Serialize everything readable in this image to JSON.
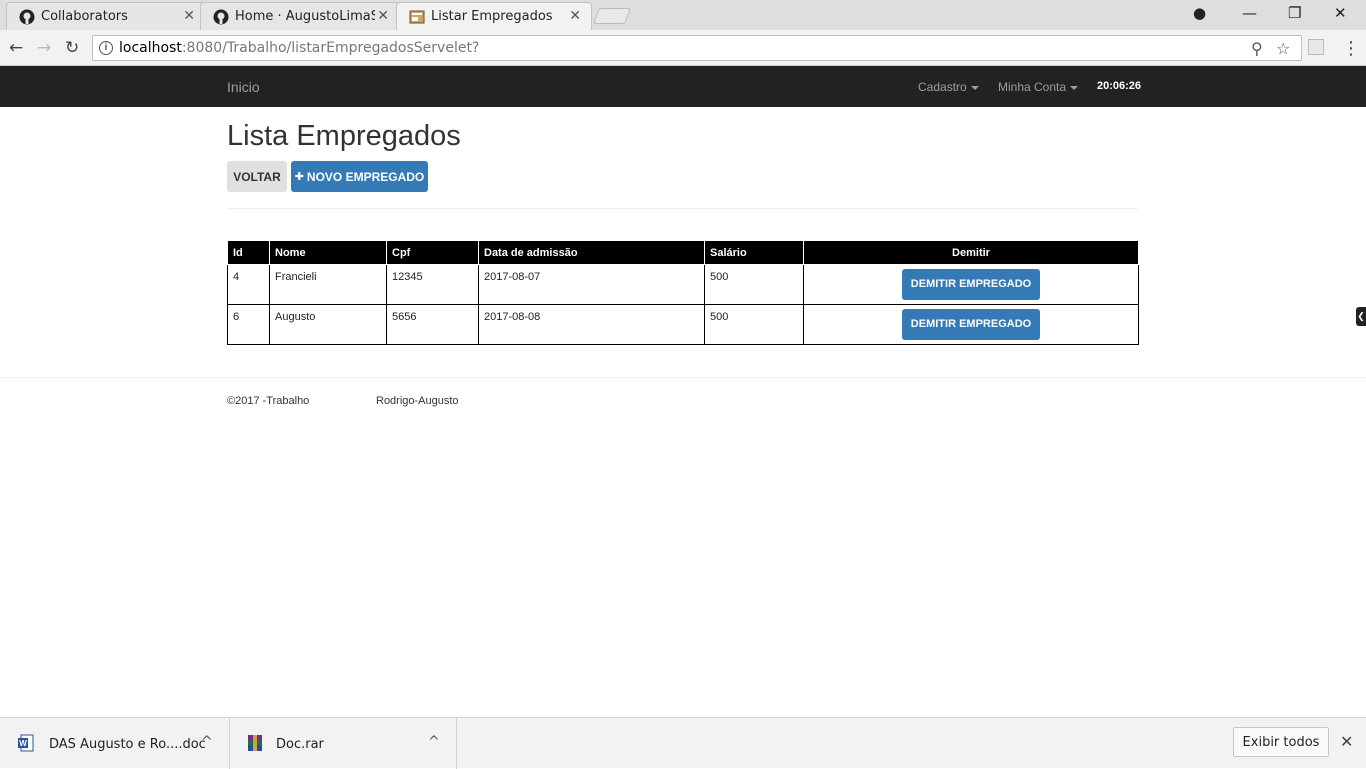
{
  "browser": {
    "tabs": [
      {
        "title": "Collaborators",
        "icon": "github-icon",
        "close": "✕"
      },
      {
        "title": "Home · AugustoLimaSan",
        "icon": "github-icon",
        "close": "✕"
      },
      {
        "title": "Listar Empregados",
        "icon": "page-icon",
        "close": "✕"
      }
    ],
    "url_host": "localhost",
    "url_rest": ":8080/Trabalho/listarEmpregadosServelet?",
    "window_controls": {
      "account": "●",
      "minimize": "—",
      "restore": "❐",
      "close": "✕"
    },
    "nav": {
      "back": "←",
      "forward": "→",
      "reload": "↻"
    },
    "omnibox_icons": {
      "zoom": "⚲",
      "star": "☆",
      "info": "i"
    },
    "menu": "⋮"
  },
  "navbar": {
    "brand": "Inicio",
    "items": [
      {
        "label": "Cadastro"
      },
      {
        "label": "Minha Conta"
      }
    ],
    "clock": "20:06:26"
  },
  "page": {
    "title": "Lista Empregados",
    "back_button": "VOLTAR",
    "new_button_icon": "✚",
    "new_button": "NOVO EMPREGADO"
  },
  "table": {
    "headers": [
      "Id",
      "Nome",
      "Cpf",
      "Data de admissão",
      "Salário",
      "Demitir"
    ],
    "rows": [
      {
        "id": "4",
        "nome": "Francieli",
        "cpf": "12345",
        "data": "2017-08-07",
        "salario": "500",
        "action": "DEMITIR EMPREGADO"
      },
      {
        "id": "6",
        "nome": "Augusto",
        "cpf": "5656",
        "data": "2017-08-08",
        "salario": "500",
        "action": "DEMITIR EMPREGADO"
      }
    ]
  },
  "footer": {
    "copyright": "©2017 -Trabalho",
    "authors": "Rodrigo-Augusto"
  },
  "side_tab": "❮",
  "downloads": {
    "items": [
      {
        "name": "DAS Augusto e Ro....doc",
        "icon": "word-doc-icon"
      },
      {
        "name": "Doc.rar",
        "icon": "winrar-icon"
      }
    ],
    "chevron": "^",
    "show_all": "Exibir todos",
    "close": "✕"
  }
}
